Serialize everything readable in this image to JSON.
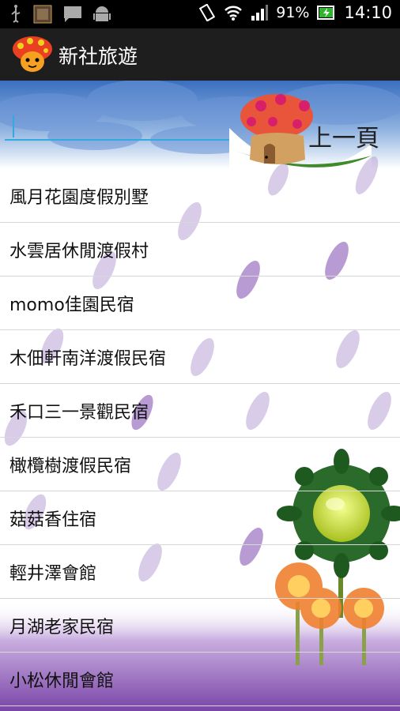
{
  "status_bar": {
    "battery_percent": "91%",
    "time": "14:10",
    "icons": [
      "usb-icon",
      "photo-icon",
      "chat-icon",
      "android-icon",
      "vibrate-icon",
      "wifi-icon",
      "signal-icon",
      "battery-icon"
    ]
  },
  "app": {
    "title": "新社旅遊",
    "icon": "mushroom-icon"
  },
  "search": {
    "value": "",
    "placeholder": ""
  },
  "prev_button_label": "上一頁",
  "list": {
    "items": [
      {
        "label": "風月花園度假別墅"
      },
      {
        "label": "水雲居休閒渡假村"
      },
      {
        "label": "momo佳園民宿"
      },
      {
        "label": "木佃軒南洋渡假民宿"
      },
      {
        "label": "禾口三一景觀民宿"
      },
      {
        "label": "橄欖樹渡假民宿"
      },
      {
        "label": "菇菇香住宿"
      },
      {
        "label": "輕井澤會館"
      },
      {
        "label": "月湖老家民宿"
      },
      {
        "label": "小松休閒會館"
      }
    ]
  },
  "colors": {
    "accent": "#33aadd",
    "sky": "#4a7fc4",
    "purple": "#7a4aa0",
    "mushroom_cap": "#e85030"
  }
}
